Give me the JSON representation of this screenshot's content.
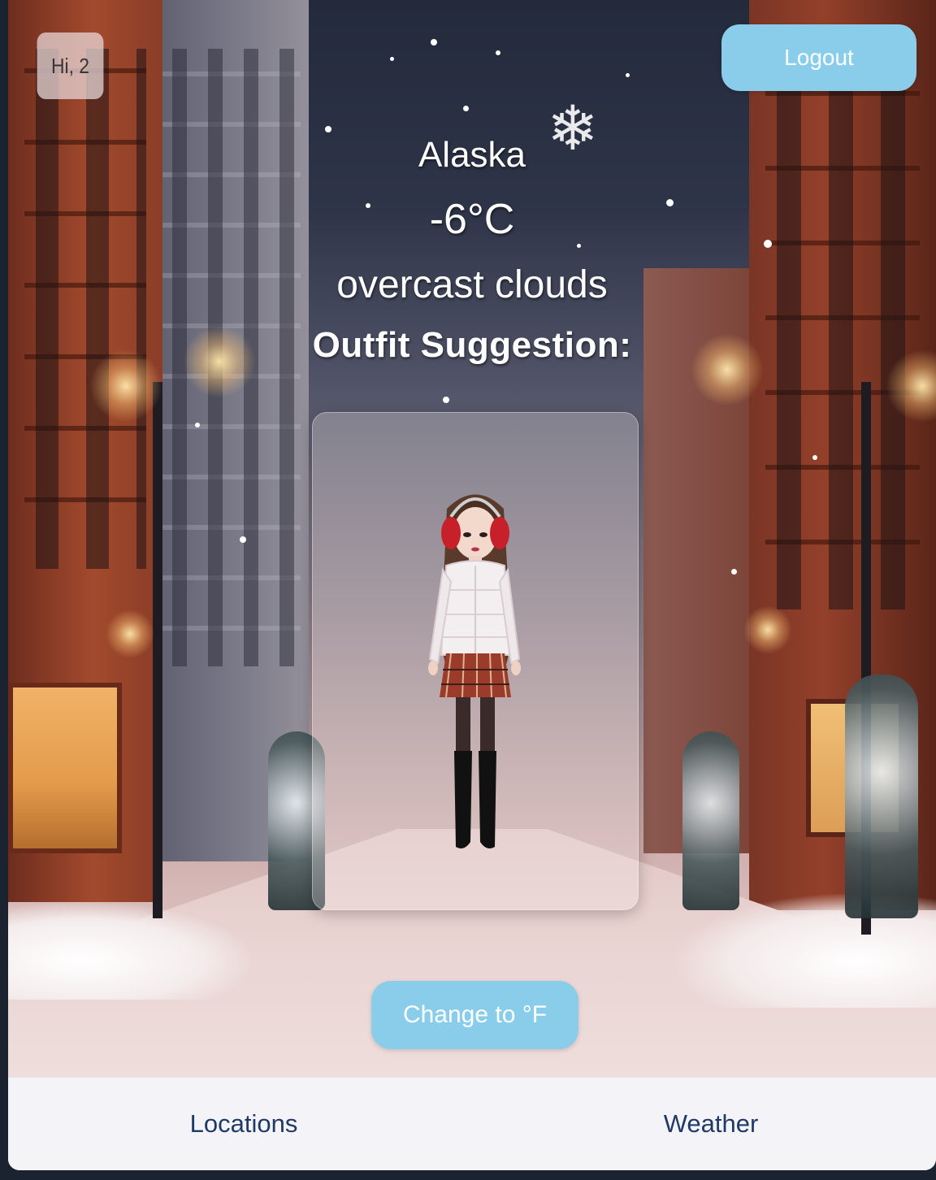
{
  "header": {
    "greeting": "Hi, 2",
    "logout_label": "Logout"
  },
  "weather": {
    "location": "Alaska",
    "temperature": "-6°C",
    "description": "overcast clouds",
    "outfit_heading": "Outfit Suggestion:"
  },
  "outfit": {
    "items": [
      "red-earmuffs-icon",
      "white-puffer-jacket-icon",
      "plaid-skirt-icon",
      "black-boots-icon"
    ]
  },
  "controls": {
    "unit_toggle_label": "Change to °F"
  },
  "nav": {
    "items": [
      {
        "label": "Locations"
      },
      {
        "label": "Weather"
      }
    ]
  },
  "colors": {
    "button_bg": "#89cdea",
    "button_text": "#ffffff",
    "nav_text": "#1f3a66"
  }
}
